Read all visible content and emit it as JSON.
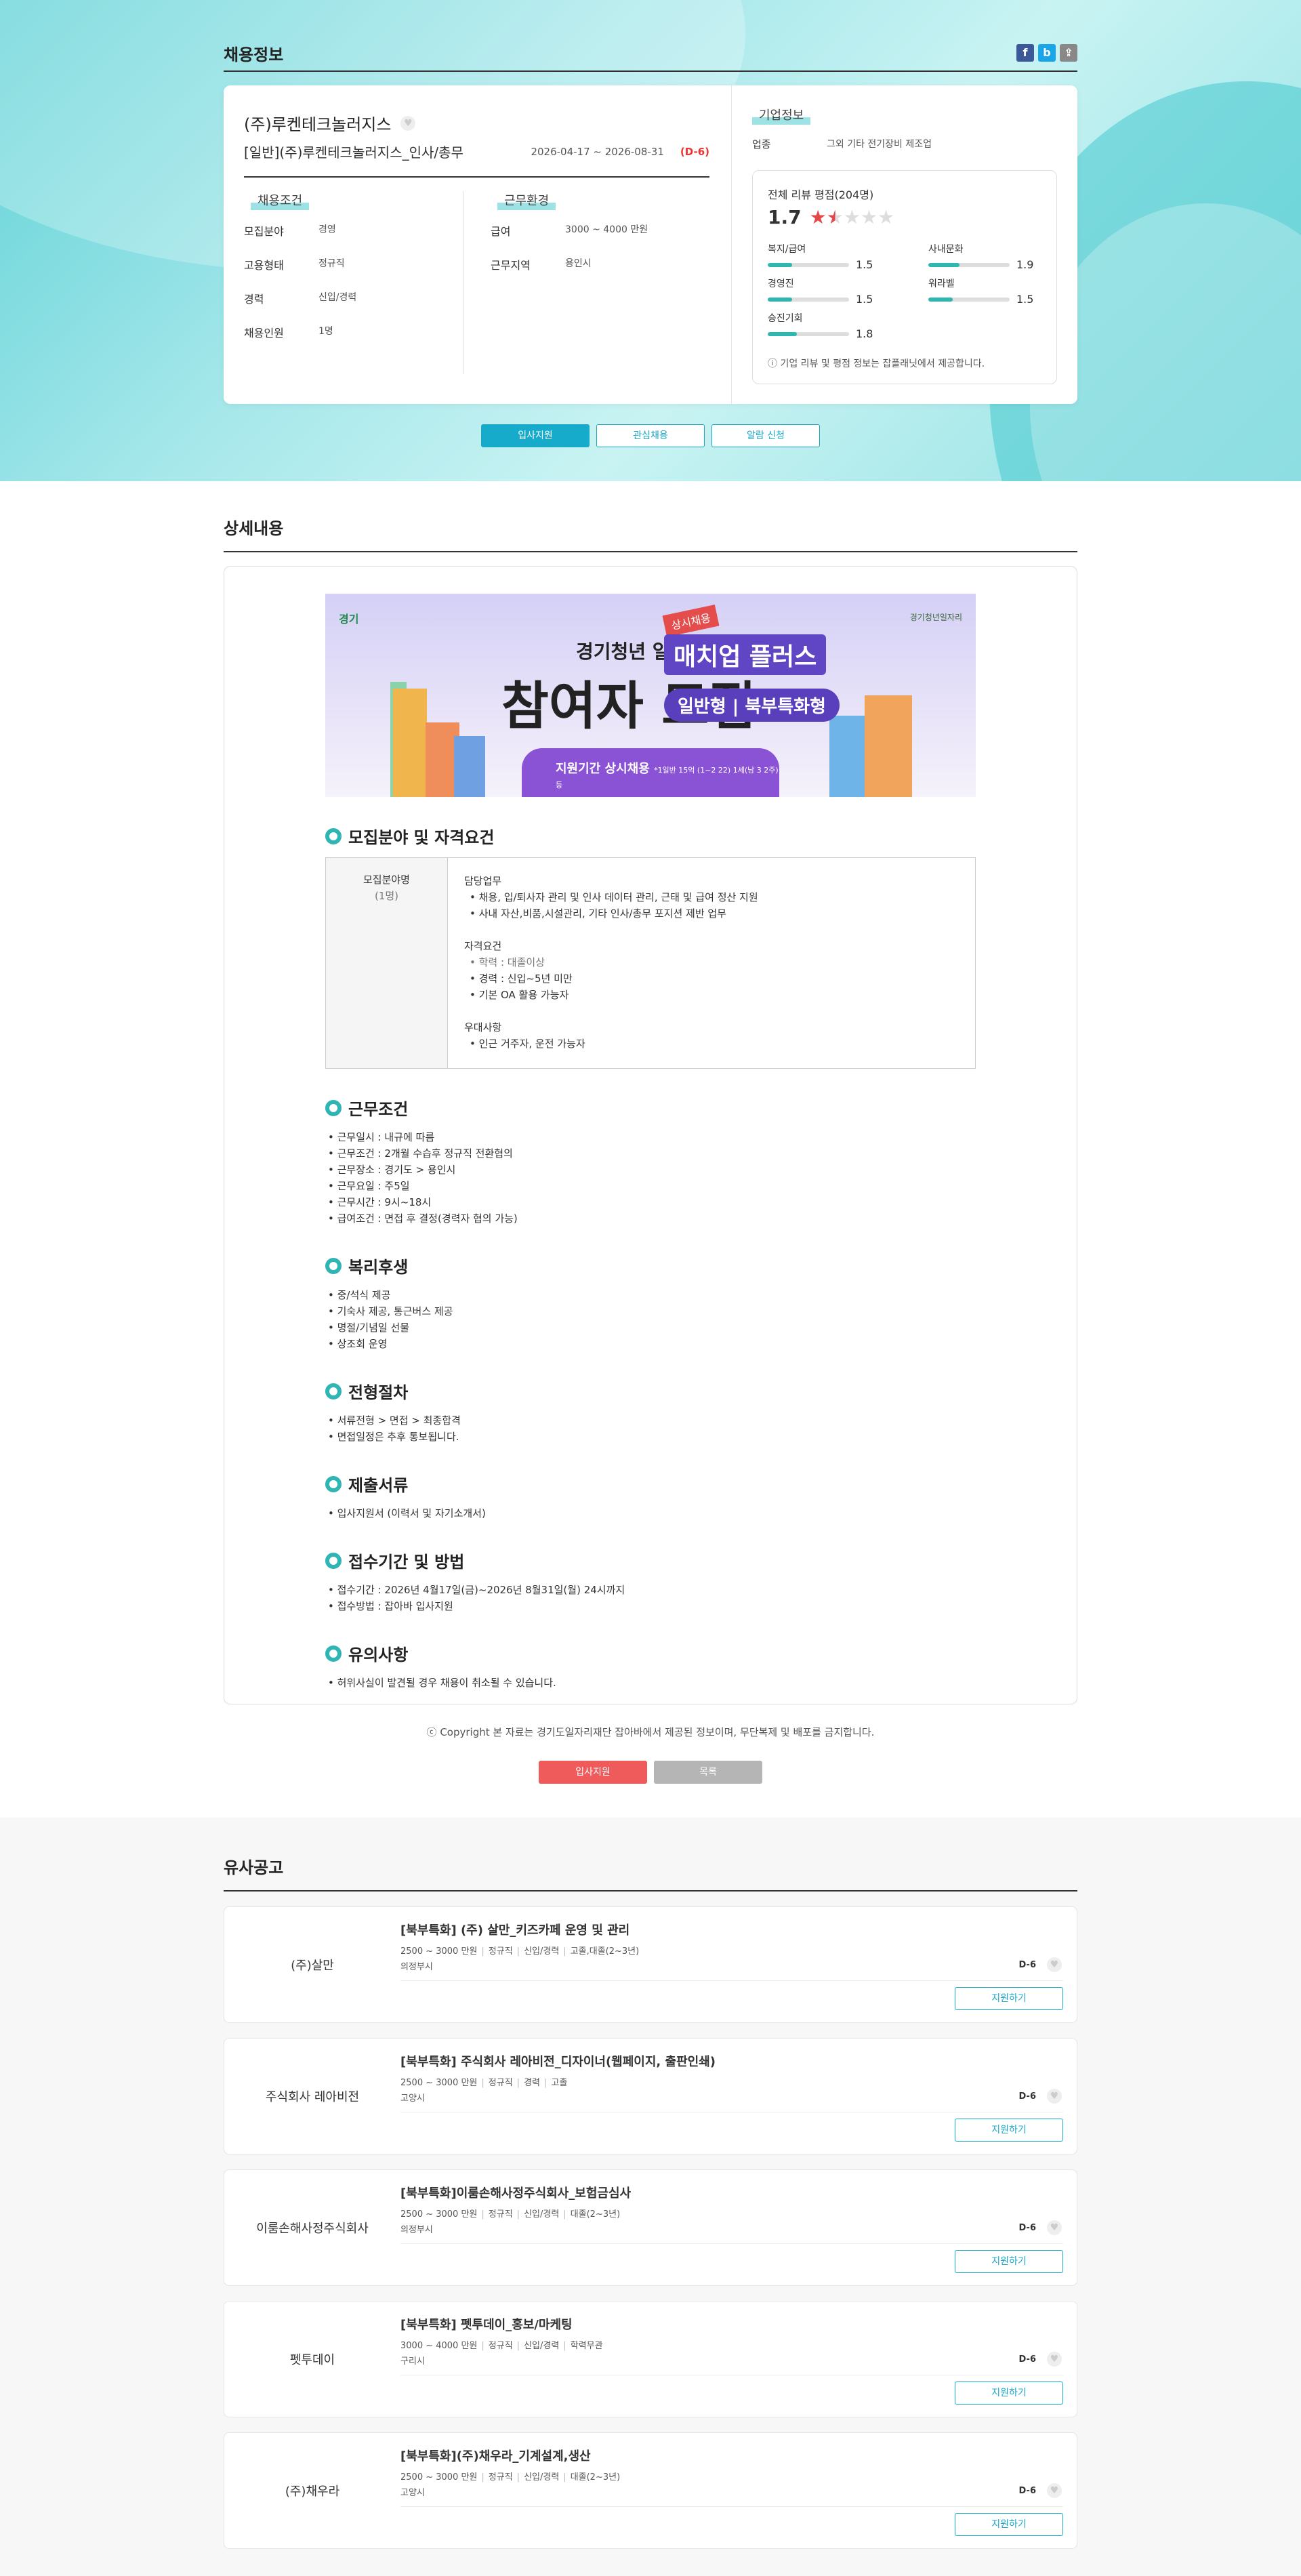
{
  "header": {
    "title": "채용정보",
    "share_icons": [
      "facebook-icon",
      "blog-icon",
      "link-icon"
    ]
  },
  "job": {
    "company": "(주)루켄테크놀러지스",
    "title": "[일반](주)루켄테크놀러지스_인사/총무",
    "period": "2026-04-17 ~ 2026-08-31",
    "dday": "(D-6)"
  },
  "conditions": {
    "label": "채용조건",
    "items": [
      {
        "k": "모집분야",
        "v": "경영"
      },
      {
        "k": "고용형태",
        "v": "정규직"
      },
      {
        "k": "경력",
        "v": "신입/경력"
      },
      {
        "k": "채용인원",
        "v": "1명"
      }
    ]
  },
  "environment": {
    "label": "근무환경",
    "items": [
      {
        "k": "급여",
        "v": "3000 ~ 4000 만원"
      },
      {
        "k": "근무지역",
        "v": "용인시"
      }
    ]
  },
  "company_info": {
    "label": "기업정보",
    "industry_k": "업종",
    "industry_v": "그외 기타 전기장비 제조업",
    "review_title": "전체 리뷰 평점(204명)",
    "score": "1.7",
    "rating": 1.7,
    "bars": [
      {
        "name": "복지/급여",
        "value": "1.5",
        "ratio": 0.3
      },
      {
        "name": "사내문화",
        "value": "1.9",
        "ratio": 0.38
      },
      {
        "name": "경영진",
        "value": "1.5",
        "ratio": 0.3
      },
      {
        "name": "워라벨",
        "value": "1.5",
        "ratio": 0.3
      },
      {
        "name": "승진기회",
        "value": "1.8",
        "ratio": 0.36
      }
    ],
    "note": "기업 리뷰 및 평점 정보는 잡플래닛에서 제공합니다."
  },
  "actions": {
    "apply": "입사지원",
    "interest": "관심채용",
    "alert": "알람 신청"
  },
  "detail": {
    "title": "상세내용",
    "banner": {
      "logo": "경기",
      "logo2": "경기청년일자리",
      "t1": "경기청년 일자리",
      "t2": "참여자 모집",
      "sticker": "상시채용",
      "mp": "매치업 플러스",
      "sub": "일반형 | 북부특화형",
      "strip_a": "지원기간",
      "strip_b": "상시채용",
      "strip_c": "*1일반 15억 (1~2 22) 1세(남 3 2주) 등"
    },
    "recruit": {
      "heading": "모집분야 및 자격요건",
      "field": "모집분야명",
      "count": "(1명)",
      "duty_title": "담당업무",
      "duties": [
        "• 채용, 입/퇴사자 관리 및 인사 데이터 관리, 근태 및 급여 정산 지원",
        "• 사내 자산,비품,시설관리, 기타 인사/총무 포지션 제반 업무"
      ],
      "qual_title": "자격요건",
      "quals": [
        "• 학력 : 대졸이상",
        "• 경력 : 신입~5년 미만",
        "• 기본 OA 활용 가능자"
      ],
      "pref_title": "우대사항",
      "prefs": [
        "• 인근 거주자, 운전 가능자"
      ]
    },
    "sections": [
      {
        "heading": "근무조건",
        "items": [
          "• 근무일시 : 내규에 따름",
          "• 근무조건 : 2개월 수습후 정규직 전환협의",
          "• 근무장소 : 경기도 > 용인시",
          "• 근무요일 : 주5일",
          "• 근무시간 : 9시~18시",
          "• 급여조건 : 면접 후 결정(경력자 협의 가능)"
        ]
      },
      {
        "heading": "복리후생",
        "items": [
          "• 중/석식 제공",
          "• 기숙사 제공, 통근버스 제공",
          "• 명절/기념일 선물",
          "• 상조회 운영"
        ]
      },
      {
        "heading": "전형절차",
        "items": [
          "• 서류전형 > 면접 >  최종합격",
          "• 면접일정은 추후 통보됩니다."
        ]
      },
      {
        "heading": "제출서류",
        "items": [
          "• 입사지원서 (이력서 및 자기소개서)"
        ]
      },
      {
        "heading": "접수기간 및 방법",
        "items": [
          "• 접수기간 :  2026년 4월17일(금)~2026년 8월31일(월) 24시까지",
          "• 접수방법 : 잡아바 입사지원"
        ]
      },
      {
        "heading": "유의사항",
        "items": [
          "• 허위사실이 발견될 경우 채용이 취소될 수 있습니다."
        ]
      }
    ],
    "copyright": "ⓒ Copyright 본 자료는 경기도일자리재단 잡아바에서 제공된 정보이며, 무단복제 및 배포를 금지합니다.",
    "btn_apply": "입사지원",
    "btn_list": "목록"
  },
  "similar": {
    "title": "유사공고",
    "apply_label": "지원하기",
    "items": [
      {
        "company": "(주)살만",
        "title": "[북부특화] (주) 살만_키즈카페 운영 및 관리",
        "salary": "2500 ~ 3000 만원",
        "type": "정규직",
        "career": "신입/경력",
        "edu": "고졸,대졸(2~3년)",
        "loc": "의정부시",
        "dday": "D-6"
      },
      {
        "company": "주식회사 레아비전",
        "title": "[북부특화] 주식회사 레아비전_디자이너(웹페이지, 출판인쇄)",
        "salary": "2500 ~ 3000 만원",
        "type": "정규직",
        "career": "경력",
        "edu": "고졸",
        "loc": "고양시",
        "dday": "D-6"
      },
      {
        "company": "이룸손해사정주식회사",
        "title": "[북부특화]이룸손해사정주식회사_보험금심사",
        "salary": "2500 ~ 3000 만원",
        "type": "정규직",
        "career": "신입/경력",
        "edu": "대졸(2~3년)",
        "loc": "의정부시",
        "dday": "D-6"
      },
      {
        "company": "펫투데이",
        "title": "[북부특화] 펫투데이_홍보/마케팅",
        "salary": "3000 ~ 4000 만원",
        "type": "정규직",
        "career": "신입/경력",
        "edu": "학력무관",
        "loc": "구리시",
        "dday": "D-6"
      },
      {
        "company": "(주)채우라",
        "title": "[북부특화](주)채우라_기계설계,생산",
        "salary": "2500 ~ 3000 만원",
        "type": "정규직",
        "career": "신입/경력",
        "edu": "대졸(2~3년)",
        "loc": "고양시",
        "dday": "D-6"
      }
    ]
  }
}
